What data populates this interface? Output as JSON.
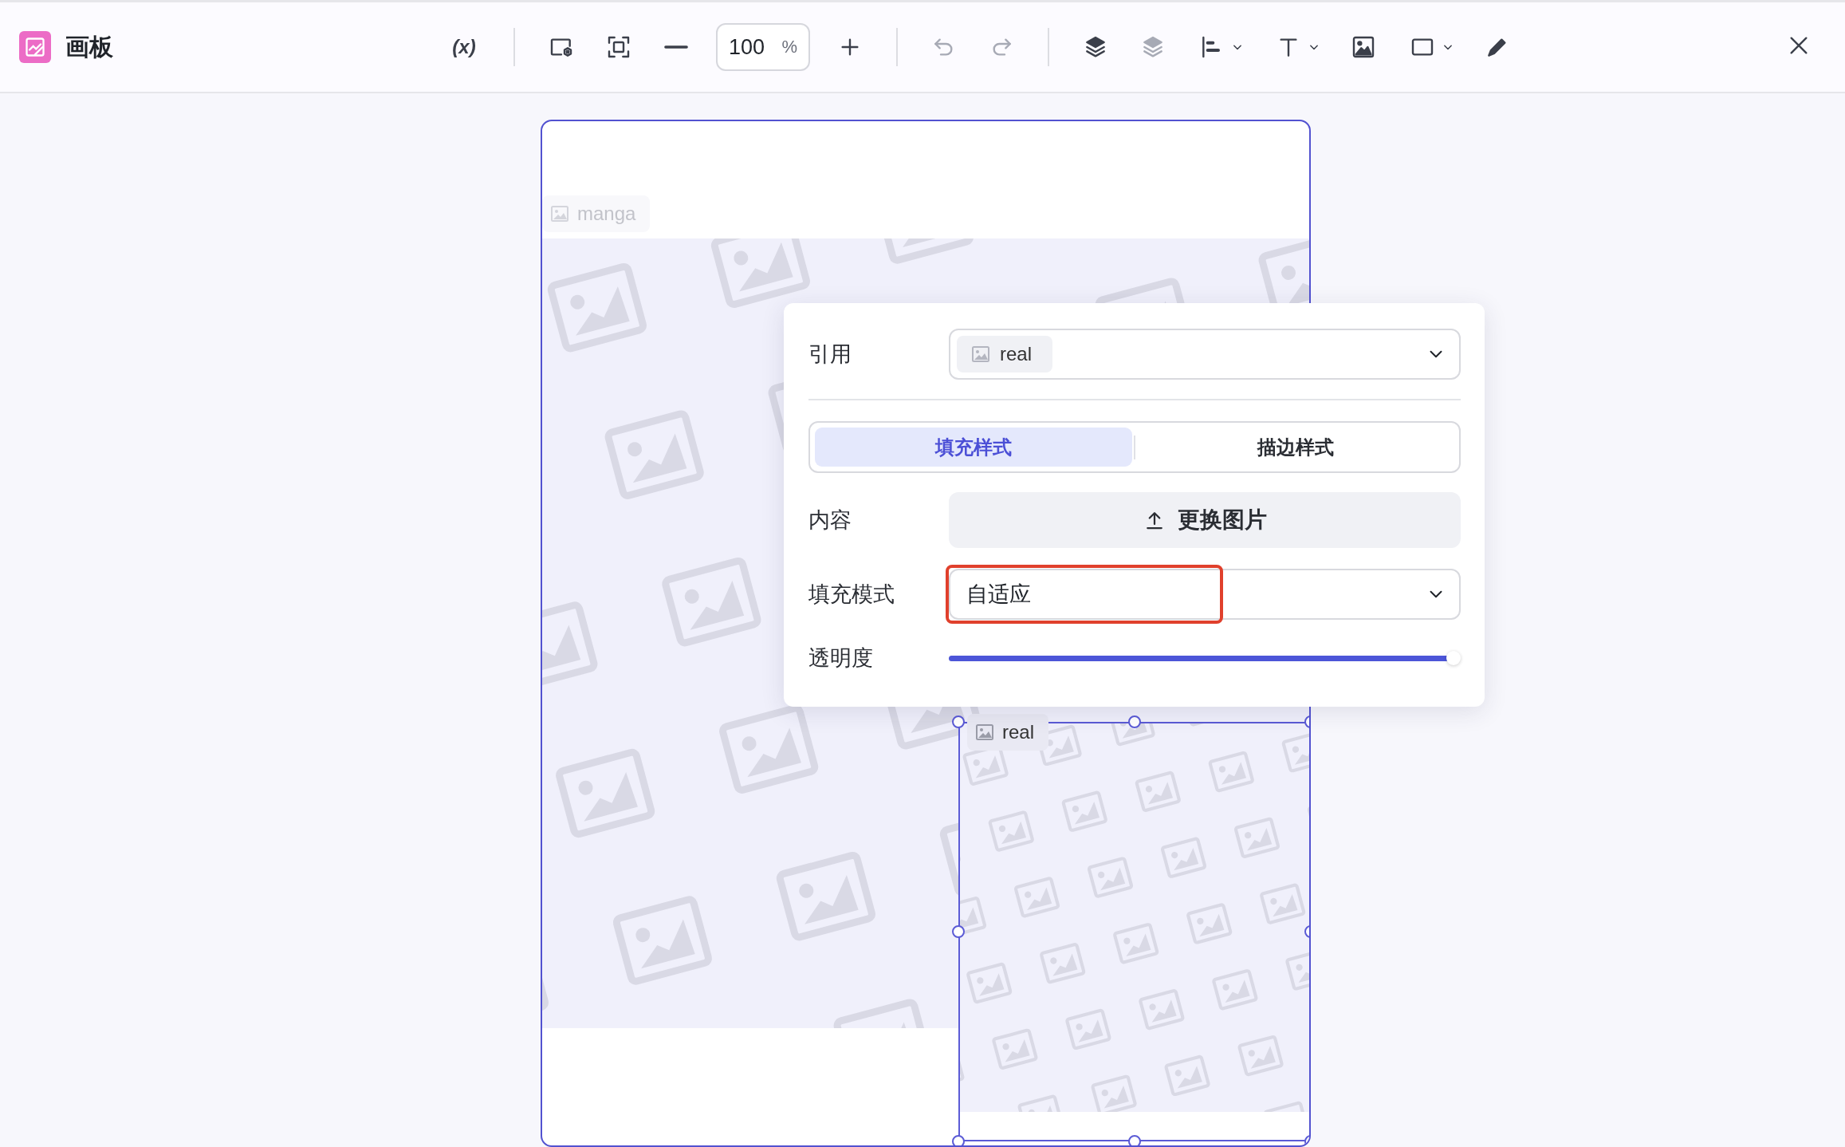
{
  "app": {
    "title": "画板"
  },
  "toolbar": {
    "variable_button": "(x)",
    "zoom": {
      "value": "100",
      "unit": "%"
    }
  },
  "artboard": {
    "layers": [
      {
        "label": "manga",
        "selected": false
      },
      {
        "label": "real",
        "selected": true
      }
    ]
  },
  "panel": {
    "reference": {
      "label": "引用",
      "value": "real"
    },
    "tabs": [
      {
        "label": "填充样式",
        "selected": true
      },
      {
        "label": "描边样式",
        "selected": false
      }
    ],
    "content": {
      "label": "内容",
      "button": "更换图片"
    },
    "fill_mode": {
      "label": "填充模式",
      "value": "自适应",
      "highlighted": true
    },
    "opacity": {
      "label": "透明度",
      "level": 1
    }
  }
}
